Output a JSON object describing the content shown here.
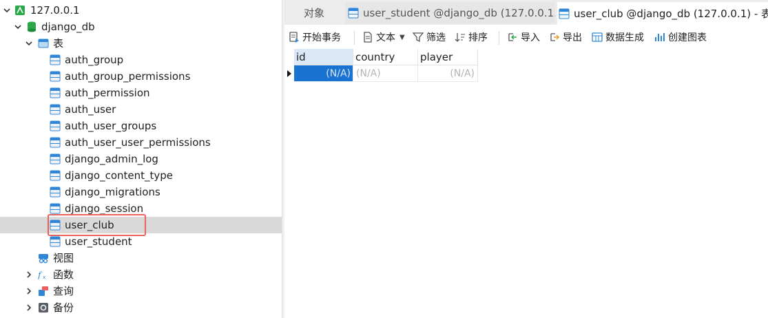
{
  "tree": {
    "connection": "127.0.0.1",
    "database": "django_db",
    "tables_group": "表",
    "tables": [
      "auth_group",
      "auth_group_permissions",
      "auth_permission",
      "auth_user",
      "auth_user_groups",
      "auth_user_user_permissions",
      "django_admin_log",
      "django_content_type",
      "django_migrations",
      "django_session",
      "user_club",
      "user_student"
    ],
    "selected_table": "user_club",
    "views": "视图",
    "functions": "函数",
    "queries": "查询",
    "backups": "备份"
  },
  "tabs": {
    "objects": "对象",
    "tab1": "user_student @django_db (127.0.0.1...",
    "tab2": "user_club @django_db (127.0.0.1) - 表"
  },
  "toolbar": {
    "begin_transaction": "开始事务",
    "text": "文本",
    "filter": "筛选",
    "sort": "排序",
    "import": "导入",
    "export": "导出",
    "data_generation": "数据生成",
    "create_chart": "创建图表"
  },
  "grid": {
    "columns": [
      "id",
      "country",
      "player"
    ],
    "rows": [
      [
        "(N/A)",
        "(N/A)",
        "(N/A)"
      ]
    ]
  },
  "colors": {
    "selection_row": "#d9d9d9",
    "highlight_box": "#e8615b",
    "selected_cell": "#1a73d1",
    "table_icon": "#2f86d6",
    "database_icon": "#2aa84a"
  }
}
